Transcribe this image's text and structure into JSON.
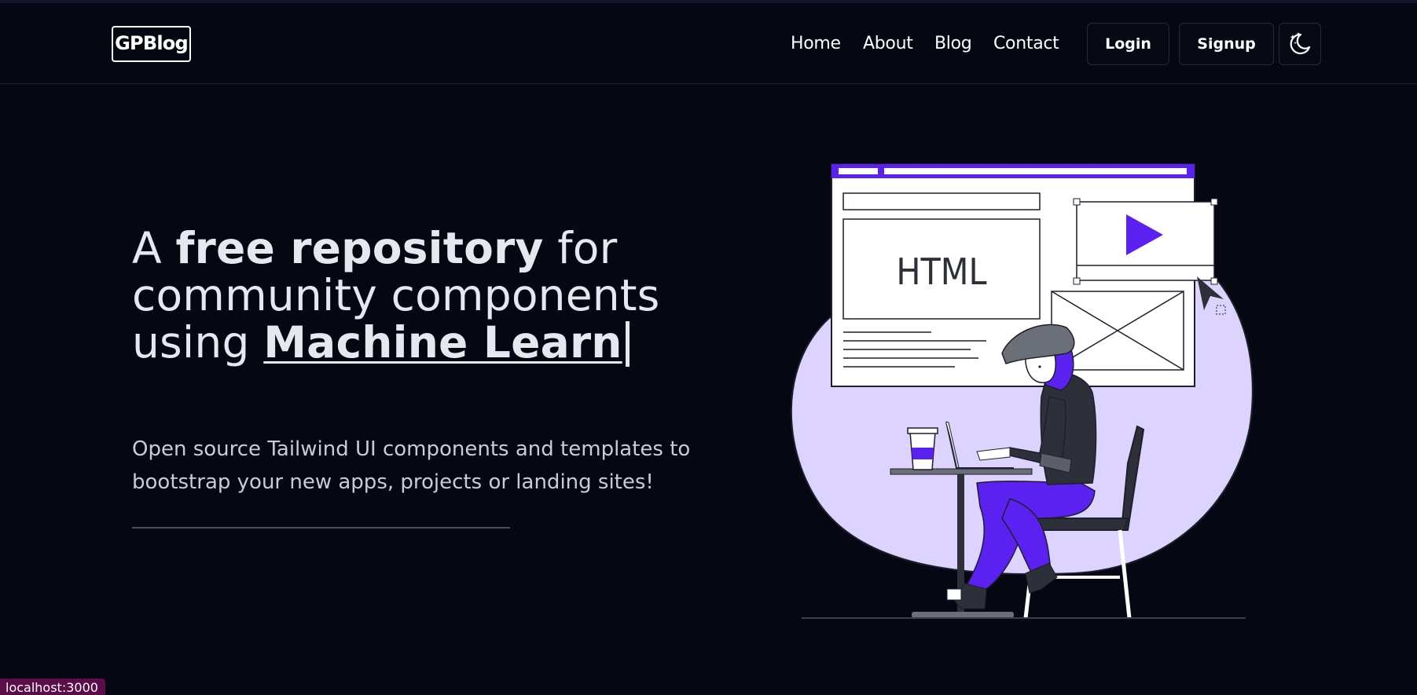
{
  "header": {
    "logo": "GPBlog",
    "nav": [
      "Home",
      "About",
      "Blog",
      "Contact"
    ],
    "login_label": "Login",
    "signup_label": "Signup",
    "theme_icon": "moon-stars-icon"
  },
  "hero": {
    "title_part1": "A ",
    "title_bold": "free repository",
    "title_part2": " for community components using ",
    "typed_text": "Machine Learn",
    "subtitle": "Open source Tailwind UI components and templates to bootstrap your new apps, projects or landing sites!"
  },
  "illustration": {
    "label": "HTML",
    "accent": "#5b21f0",
    "blob": "#ddd3ff"
  },
  "status_bar": {
    "url": "localhost:3000"
  }
}
